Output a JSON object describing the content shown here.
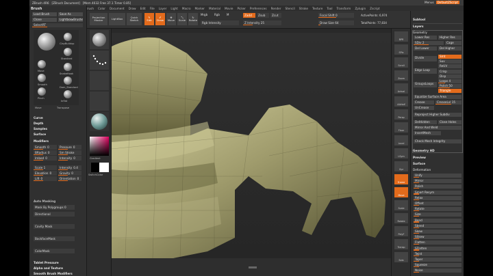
{
  "titlebar": {
    "app": "ZBrush 4R6",
    "doc": "[ZBrush Document]",
    "info": "[Mem 4032 Free 37.1 Timer 0.85]",
    "tabs": [
      "Menus",
      "DefaultZScript"
    ],
    "active_tab": "DefaultZScript"
  },
  "menubar": [
    "Alpha",
    "Brush",
    "Color",
    "Document",
    "Draw",
    "Edit",
    "File",
    "Layer",
    "Light",
    "Macro",
    "Marker",
    "Material",
    "Movie",
    "Picker",
    "Preferences",
    "Render",
    "Stencil",
    "Stroke",
    "Texture",
    "Tool",
    "Transform",
    "Zplugin",
    "Zscript"
  ],
  "left_panel": {
    "header": "Brush",
    "buttons": [
      "Load Brush",
      "Save As",
      "Clone",
      "Lightbox▸Brushes"
    ],
    "slider_top": "SelectRT",
    "brushes": [
      "ClayBuildup",
      "Standard",
      "Move",
      "SnakeHook",
      "Smooth",
      "Dam_Standard",
      "Pinch",
      "Inflat",
      "Move",
      "Transpose"
    ],
    "sections": [
      "Curve",
      "Depth",
      "Samples",
      "Surface",
      "Modifiers"
    ],
    "modifiers": [
      {
        "label": "Smooth",
        "value": "0"
      },
      {
        "label": "Pressure",
        "value": "0"
      },
      {
        "label": "BRadius",
        "value": "0"
      },
      {
        "label": "Sm Stroke",
        "value": ""
      },
      {
        "label": "Imbed",
        "value": "0"
      },
      {
        "label": "Intensity",
        "value": "0"
      },
      {
        "label": "Scale 1",
        "value": ""
      },
      {
        "label": "Intensity",
        "value": "0.4"
      },
      {
        "label": "Elevation",
        "value": "0"
      },
      {
        "label": "Gravity",
        "value": "0"
      },
      {
        "label": "Lift",
        "value": "0"
      },
      {
        "label": "Orientation",
        "value": "0"
      }
    ],
    "auto_masking_title": "Auto Masking",
    "auto_masking": [
      "Mask By Polygroups 0",
      "Directional",
      "Cavity Mask",
      "BackfaceMask",
      "ColorMask"
    ],
    "footer": [
      "Tablet Pressure",
      "Alpha and Texture",
      "Smooth Brush Modifiers"
    ]
  },
  "toolbar": {
    "projection": "Projection Master",
    "lightbox": "LightBox",
    "quicksketch": "Quick Sketch",
    "modes": [
      "Edit",
      "Draw",
      "Move",
      "Scale",
      "Rotate"
    ],
    "mrgb": "Mrgb",
    "rgb": "Rgb",
    "m": "M",
    "zadd": "Zadd",
    "zsub": "Zsub",
    "zcut": "Zcut",
    "rgb_intensity": "Rgb Intensity",
    "z_intensity": "Z Intensity 25",
    "focal_shift": "Focal Shift 0",
    "draw_size": "Draw Size 64",
    "active_points": "ActivePoints: 6,974",
    "total_points": "TotalPoints: 77,834"
  },
  "material_column": {
    "gradient_label": "Gradient",
    "switch_label": "SwitchColor"
  },
  "right_icons": [
    "BPR",
    "SPix",
    "Scroll",
    "Zoom",
    "Actual",
    "AAHalf",
    "Persp",
    "Floor",
    "Local",
    "LSym",
    "Xyz",
    "Frame",
    "Move",
    "Scale",
    "Rotate",
    "PolyF",
    "Transp",
    "Solo"
  ],
  "right_panel": {
    "subtool": "Subtool",
    "layers": "Layers",
    "geometry": "Geometry",
    "geometry_rows": [
      [
        "Lower Res",
        "Higher Res"
      ],
      [
        "SDiv 2",
        "Cage"
      ],
      [
        "Del Lower",
        "Del Higher"
      ]
    ],
    "divide": "Divide",
    "smt": "Smt",
    "suv": "Suv",
    "reuv": "ReUV",
    "edge_loop": "Edge Loop",
    "crisp": "Crisp",
    "disp": "Disp",
    "groups_loops": "GroupsLoops",
    "loops": "Loops 4",
    "polish": "Polish 50",
    "triangle": "Triangle",
    "equalize": "Equalize Surface Area",
    "crease": "Crease",
    "crease_val": "CreaseLvl 15",
    "uncrease": "UnCrease",
    "reproject": "Reproject Higher Subdiv",
    "del_hidden": "DelHidden",
    "close_holes": "Close Holes",
    "mirror_weld": "Mirror And Weld",
    "insert_mesh": "InsertMesh",
    "check_mesh": "Check Mesh Integrity",
    "geometry_hd": "Geometry HD",
    "preview": "Preview",
    "surface": "Surface",
    "deformation": "Deformation",
    "deform_rows": [
      "Unify",
      "Mirror",
      "Polish",
      "Smart Resym",
      "Relax",
      "Offset",
      "Rotate",
      "Size",
      "Bend",
      "Sbend",
      "Skew",
      "SSkew",
      "Flatten",
      "SFlatten",
      "Twist",
      "Taper",
      "Squeeze",
      "Noise"
    ]
  }
}
